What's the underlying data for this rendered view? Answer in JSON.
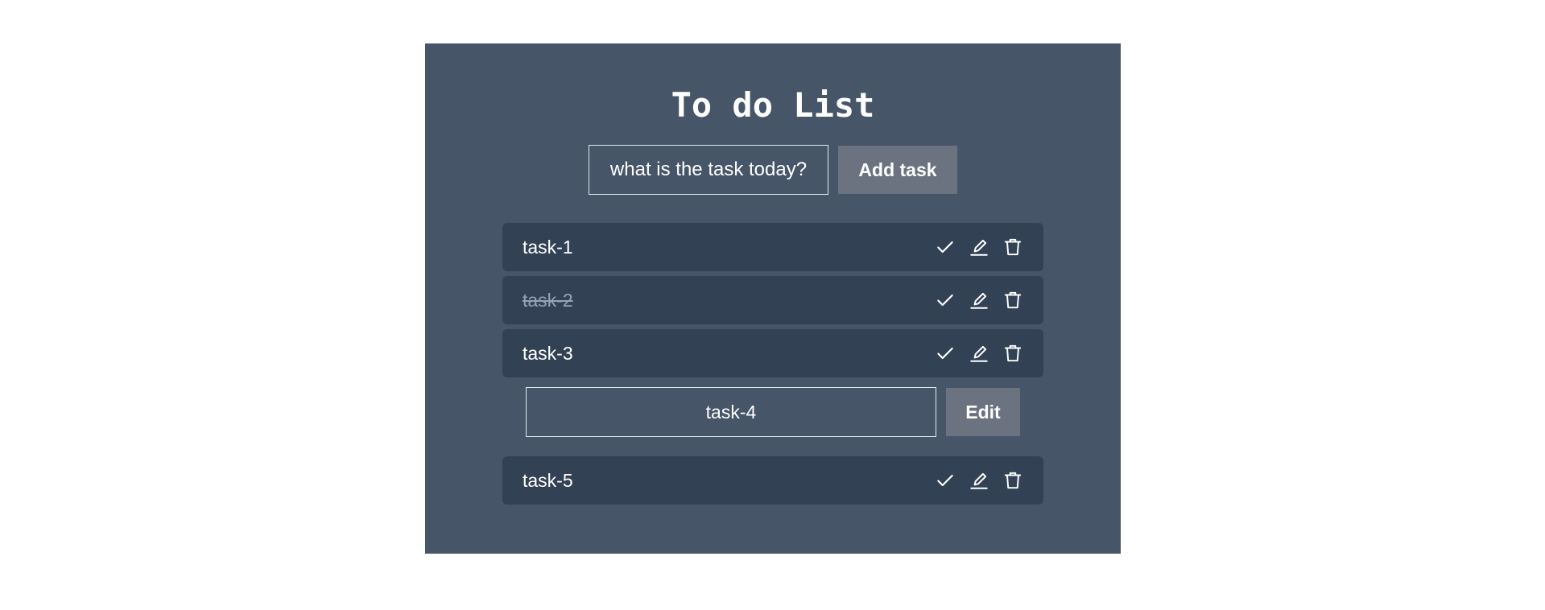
{
  "app": {
    "title": "To do List",
    "add_input_placeholder": "what is the task today?",
    "add_button_label": "Add task"
  },
  "tasks": [
    {
      "label": "task-1",
      "completed": false
    },
    {
      "label": "task-2",
      "completed": true
    },
    {
      "label": "task-3",
      "completed": false
    },
    {
      "label": "task-5",
      "completed": false
    }
  ],
  "edit": {
    "value": "task-4",
    "button_label": "Edit"
  },
  "icons": {
    "complete": "check-icon",
    "edit": "pencil-icon",
    "delete": "trash-icon"
  },
  "colors": {
    "page_background": "#ffffff",
    "app_background": "#475569",
    "task_background": "#334155",
    "button_background": "#6b7280",
    "text": "#ffffff",
    "completed_text": "#94a3b8"
  }
}
